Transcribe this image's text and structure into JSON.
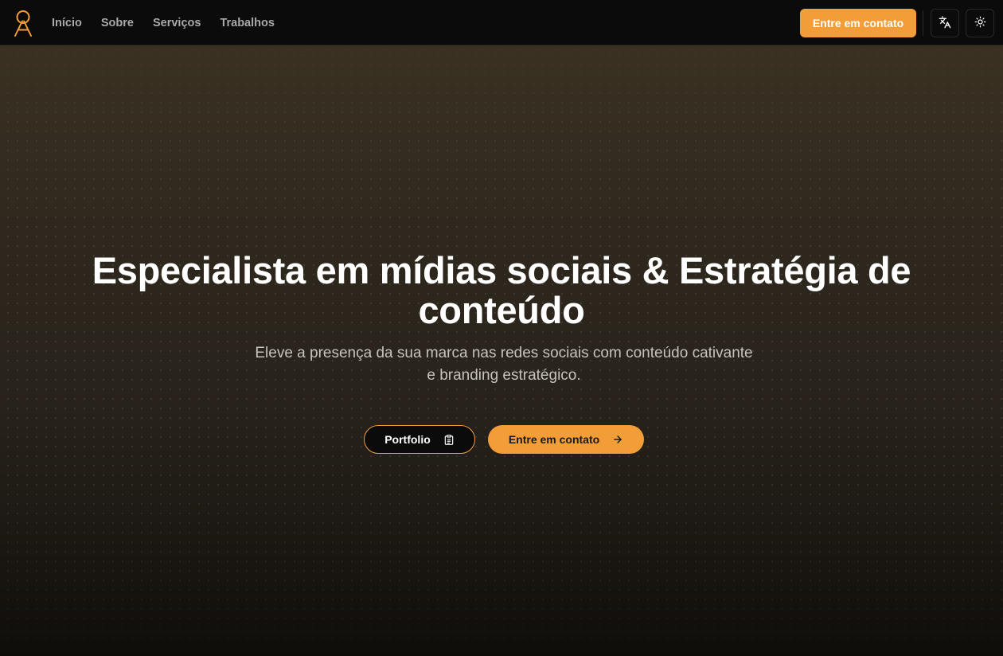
{
  "brand": {
    "logo_icon": "brand-logo-icon",
    "accent_color": "#f29d38"
  },
  "nav": {
    "links": [
      {
        "label": "Início"
      },
      {
        "label": "Sobre"
      },
      {
        "label": "Serviços"
      },
      {
        "label": "Trabalhos"
      }
    ],
    "cta_label": "Entre em contato",
    "language_icon": "translate-icon",
    "theme_icon": "sun-icon"
  },
  "hero": {
    "title": "Especialista em mídias sociais & Estratégia de conteúdo",
    "subtitle": "Eleve a presença da sua marca nas redes sociais com conteúdo cativante e branding estratégico.",
    "portfolio_button": {
      "label": "Portfolio",
      "icon": "clipboard-icon"
    },
    "contact_button": {
      "label": "Entre em contato",
      "icon": "arrow-right-icon"
    }
  }
}
